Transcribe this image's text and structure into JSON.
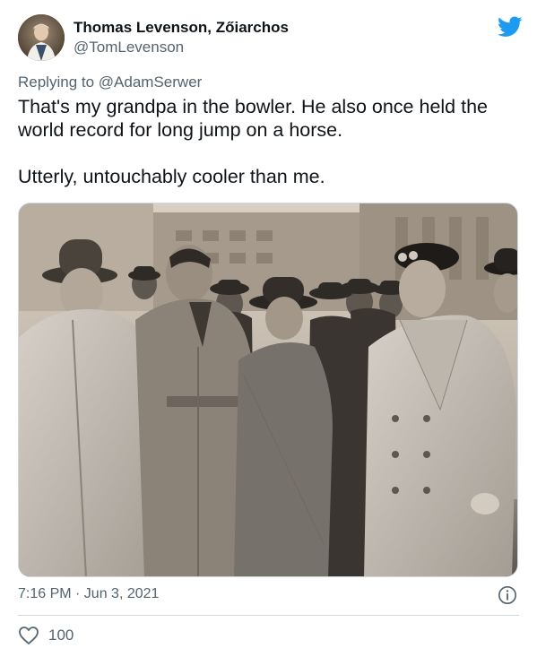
{
  "author": {
    "display_name": "Thomas Levenson, Zőiarchos",
    "handle": "@TomLevenson",
    "avatar_icon": "profile-photo"
  },
  "platform_icon": "twitter-bird-icon",
  "brand_color": "#1d9bf0",
  "reply": {
    "prefix": "Replying to",
    "mention": "@AdamSerwer"
  },
  "tweet": {
    "line1": "That's my grandpa in the bowler. He also once held the world record for long jump on a horse.",
    "line2": "Utterly, untouchably cooler than me."
  },
  "timestamp": "7:16 PM · Jun 3, 2021",
  "likes": {
    "count": "100",
    "icon": "heart-icon"
  }
}
